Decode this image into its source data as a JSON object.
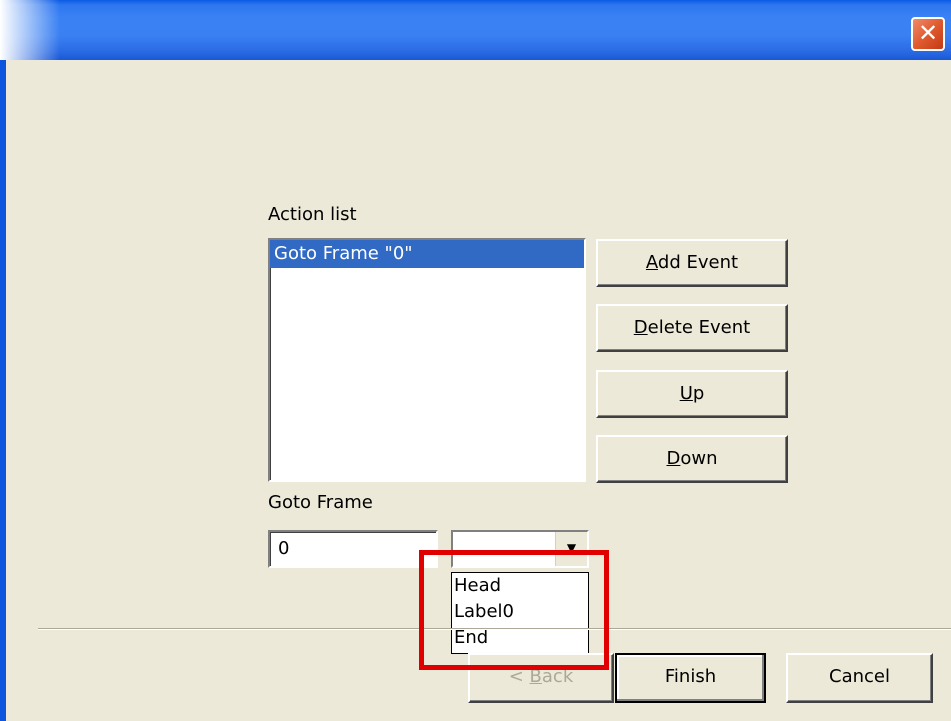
{
  "window": {
    "close_glyph": "✕"
  },
  "action_list": {
    "label": "Action list",
    "items": [
      "Goto Frame \"0\""
    ],
    "selected_index": 0
  },
  "buttons": {
    "add_event": {
      "pre": "",
      "u": "A",
      "post": "dd Event"
    },
    "delete_event": {
      "pre": "",
      "u": "D",
      "post": "elete Event"
    },
    "up": {
      "pre": "",
      "u": "U",
      "post": "p"
    },
    "down": {
      "pre": "",
      "u": "D",
      "post": "own"
    }
  },
  "goto_frame": {
    "label": "Goto Frame",
    "frame_value": "0",
    "label_value": "",
    "dropdown_arrow": "▼",
    "options": [
      "Head",
      "Label0",
      "End"
    ]
  },
  "footer": {
    "back": {
      "pre": "< ",
      "u": "B",
      "post": "ack"
    },
    "finish": "Finish",
    "cancel": "Cancel"
  },
  "colors": {
    "selection": "#316ac5",
    "highlight": "#e00000",
    "titlebar": "#3a82f4"
  }
}
